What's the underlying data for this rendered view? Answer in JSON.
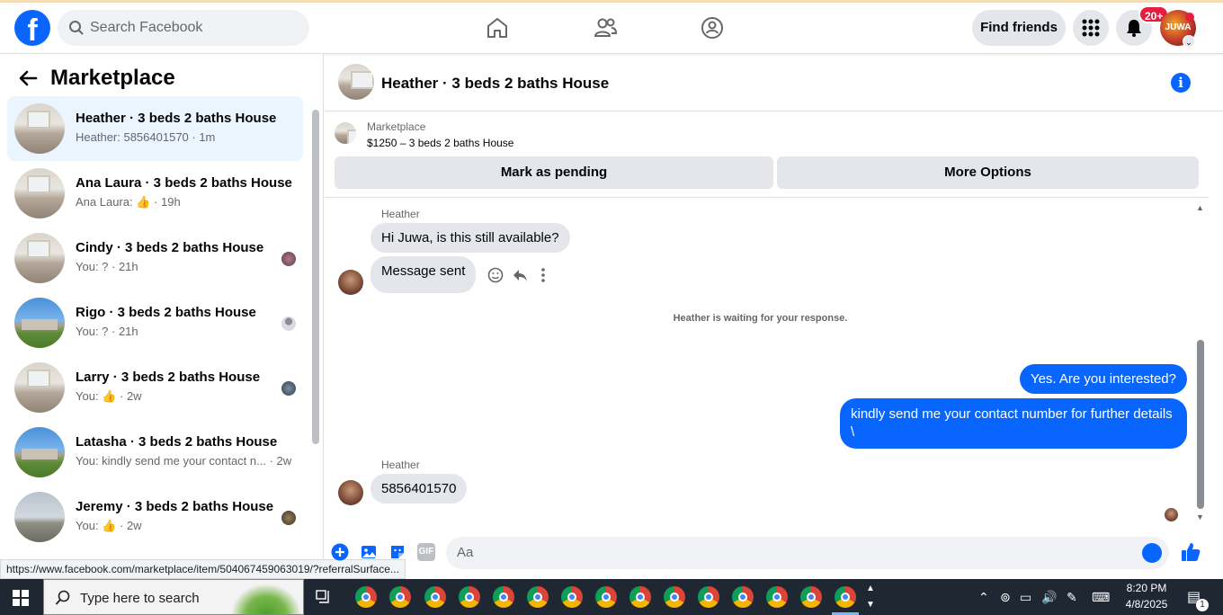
{
  "header": {
    "search_placeholder": "Search Facebook",
    "find_friends": "Find friends",
    "notifications_badge": "20+",
    "avatar_text": "JUWA"
  },
  "sidebar": {
    "title": "Marketplace",
    "conversations": [
      {
        "name": "Heather · 3 beds 2 baths House",
        "preview": "Heather: 5856401570 · 1m",
        "thumb": "room",
        "active": true
      },
      {
        "name": "Ana Laura · 3 beds 2 baths House",
        "preview": "Ana Laura:",
        "preview_suffix": "· 19h",
        "thumb": "room",
        "like_icon": true
      },
      {
        "name": "Cindy · 3 beds 2 baths House",
        "preview": "You: ? · 21h",
        "thumb": "room"
      },
      {
        "name": "Rigo · 3 beds 2 baths House",
        "preview": "You: ? · 21h",
        "thumb": "house"
      },
      {
        "name": "Larry · 3 beds 2 baths House",
        "preview": "You:",
        "preview_suffix": "· 2w",
        "thumb": "room",
        "like_icon": true
      },
      {
        "name": "Latasha · 3 beds 2 baths House",
        "preview": "You: kindly send me your contact n... · 2w",
        "thumb": "house"
      },
      {
        "name": "Jeremy · 3 beds 2 baths House",
        "preview": "You:",
        "preview_suffix": "· 2w",
        "thumb": "winter",
        "like_icon": true
      }
    ],
    "status_url": "https://www.facebook.com/marketplace/item/504067459063019/?referralSurface..."
  },
  "chat": {
    "title": "Heather · 3 beds 2 baths House",
    "listing_source": "Marketplace",
    "listing_title": "$1250 – 3 beds 2 baths House",
    "btn_pending": "Mark as pending",
    "btn_more": "More Options",
    "messages": {
      "sender1": "Heather",
      "in1": "Hi Juwa, is this still available?",
      "in2": "Message sent",
      "waiting": "Heather is waiting for your response.",
      "out1": "Yes. Are you interested?",
      "out2_line1": "kindly send me your contact number for further details",
      "out2_line2": "\\",
      "sender2": "Heather",
      "in3": "5856401570"
    },
    "composer_placeholder": "Aa"
  },
  "taskbar": {
    "search_placeholder": "Type here to search",
    "time": "8:20 PM",
    "date": "4/8/2025",
    "notif_count": "1"
  }
}
